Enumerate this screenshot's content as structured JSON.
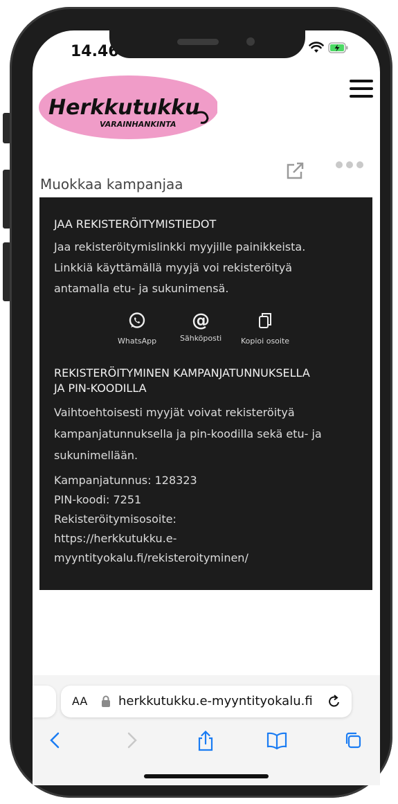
{
  "status": {
    "time": "14.46"
  },
  "brand": {
    "name": "Herkkutukku",
    "tagline": "VARAINHANKINTA",
    "pink": "#f09cc8"
  },
  "page": {
    "title": "Muokkaa kampanjaa"
  },
  "card": {
    "share_heading": "JAA REKISTERÖITYMISTIEDOT",
    "share_text": [
      "Jaa rekisteröitymislinkki myyjille painikkeista.",
      "Linkkiä käyttämällä myyjä voi rekisteröityä",
      "antamalla etu- ja sukunimensä."
    ],
    "share_buttons": [
      {
        "icon": "whatsapp-icon",
        "label": "WhatsApp"
      },
      {
        "icon": "at-icon",
        "label": "Sähköposti"
      },
      {
        "icon": "copy-icon",
        "label": "Kopioi osoite"
      }
    ],
    "code_heading": [
      "REKISTERÖITYMINEN KAMPANJATUNNUKSELLA",
      "JA PIN-KOODILLA"
    ],
    "code_text": [
      "Vaihtoehtoisesti myyjät voivat rekisteröityä",
      "kampanjatunnuksella ja pin-koodilla sekä etu- ja",
      "sukunimellään."
    ],
    "details": [
      "Kampanjatunnus: 128323",
      "PIN-koodi: 7251",
      "Rekisteröitymisosoite:",
      "https://herkkutukku.e-",
      "myyntityokalu.fi/rekisteroityminen/"
    ]
  },
  "browser": {
    "aa": "AA",
    "url": "herkkutukku.e-myyntityokalu.fi",
    "accent": "#1a7cf3"
  }
}
